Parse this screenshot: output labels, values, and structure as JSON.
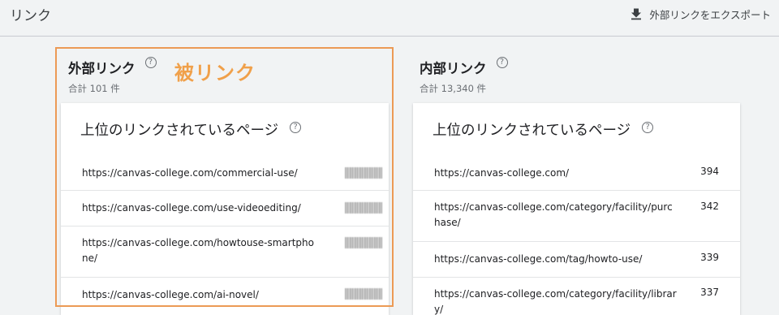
{
  "header": {
    "title": "リンク",
    "export_label": "外部リンクをエクスポート"
  },
  "external": {
    "title": "外部リンク",
    "total": "合計 101 件",
    "help": "?",
    "annotation": "被リンク",
    "card_title": "上位のリンクされているページ",
    "rows": [
      {
        "url": "https://canvas-college.com/commercial-use/",
        "count": ""
      },
      {
        "url": "https://canvas-college.com/use-videoediting/",
        "count": ""
      },
      {
        "url": "https://canvas-college.com/howtouse-smartphone/",
        "count": ""
      },
      {
        "url": "https://canvas-college.com/ai-novel/",
        "count": ""
      }
    ]
  },
  "internal": {
    "title": "内部リンク",
    "total": "合計 13,340 件",
    "help": "?",
    "card_title": "上位のリンクされているページ",
    "rows": [
      {
        "url": "https://canvas-college.com/",
        "count": "394"
      },
      {
        "url": "https://canvas-college.com/category/facility/purchase/",
        "count": "342"
      },
      {
        "url": "https://canvas-college.com/tag/howto-use/",
        "count": "339"
      },
      {
        "url": "https://canvas-college.com/category/facility/library/",
        "count": "337"
      }
    ]
  },
  "colors": {
    "annotation": "#f0a04a",
    "highlight_border": "#ec9a55"
  }
}
